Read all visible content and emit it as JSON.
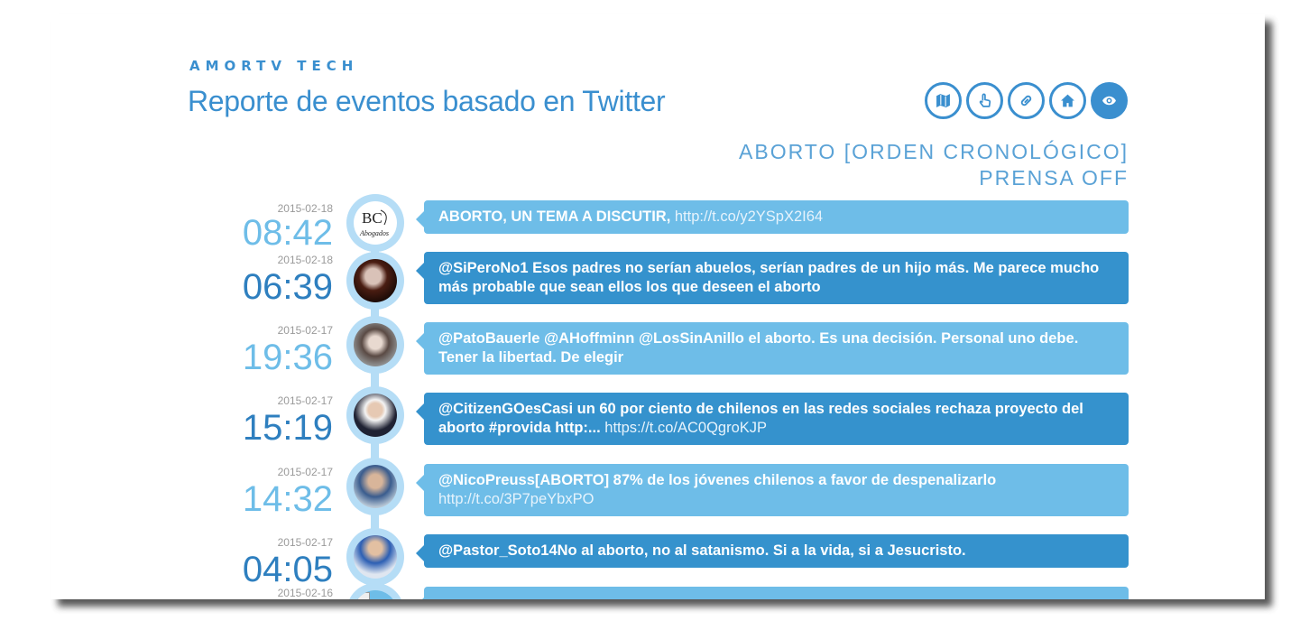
{
  "brand": "AMORTV TECH",
  "title": "Reporte de eventos basado en Twitter",
  "nav_icons": [
    {
      "name": "map-icon",
      "active": false
    },
    {
      "name": "hand-pointer-icon",
      "active": false
    },
    {
      "name": "link-icon",
      "active": false
    },
    {
      "name": "home-icon",
      "active": false
    },
    {
      "name": "eye-icon",
      "active": true
    }
  ],
  "subheading": {
    "line1": "ABORTO [ORDEN CRONOLÓGICO]",
    "line2": "PRENSA OFF"
  },
  "tweets": [
    {
      "date": "2015-02-18",
      "time": "08:42",
      "text": "ABORTO, UN TEMA A DISCUTIR,",
      "link": "http://t.co/y2YSpX2I64",
      "style": "light",
      "avatar": "logo"
    },
    {
      "date": "2015-02-18",
      "time": "06:39",
      "text": "@SiPeroNo1 Esos padres no serían abuelos, serían padres de un hijo más. Me parece mucho más probable que sean ellos los que deseen el aborto",
      "link": "",
      "style": "dark",
      "avatar": "photo"
    },
    {
      "date": "2015-02-17",
      "time": "19:36",
      "text": "@PatoBauerle @AHoffminn @LosSinAnillo el aborto. Es una decisión. Personal uno debe. Tener la libertad. De elegir",
      "link": "",
      "style": "light",
      "avatar": "photo"
    },
    {
      "date": "2015-02-17",
      "time": "15:19",
      "text": "@CitizenGOesCasi un 60 por ciento de chilenos en las redes sociales rechaza proyecto del aborto #provida http:...",
      "link": "https://t.co/AC0QgroKJP",
      "style": "dark",
      "avatar": "photo"
    },
    {
      "date": "2015-02-17",
      "time": "14:32",
      "text": "@NicoPreuss[ABORTO] 87% de los jóvenes chilenos a favor de despenalizarlo",
      "link": "http://t.co/3P7peYbxPO",
      "style": "light",
      "avatar": "photo"
    },
    {
      "date": "2015-02-17",
      "time": "04:05",
      "text": "@Pastor_Soto14No al aborto, no al satanismo. Si a la vida, si a Jesucristo.",
      "link": "",
      "style": "dark",
      "avatar": "photo"
    },
    {
      "date": "2015-02-16",
      "time": "",
      "text": "",
      "link": "",
      "style": "light",
      "avatar": "broken"
    }
  ],
  "colors": {
    "accent": "#3a8fcf",
    "bubble_light": "#6ebde8",
    "bubble_dark": "#3592cd",
    "ring": "#b5ddf6"
  }
}
